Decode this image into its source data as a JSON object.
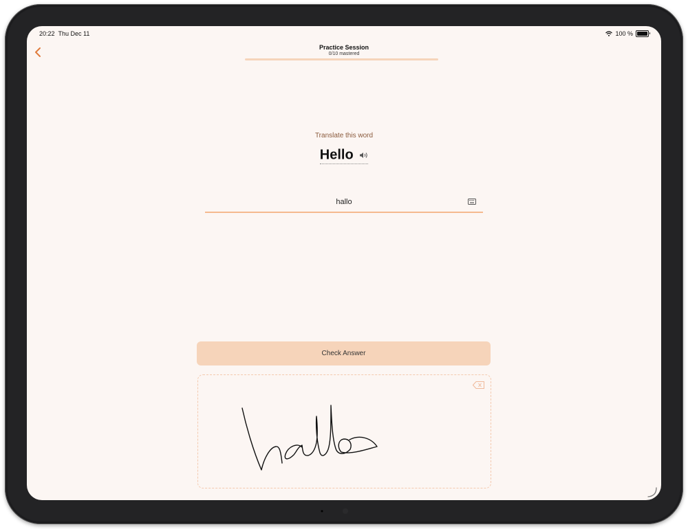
{
  "status_bar": {
    "time": "20:22",
    "date": "Thu Dec 11",
    "battery": "100 %"
  },
  "header": {
    "title": "Practice Session",
    "subtitle": "0/10 mastered",
    "progress": 0
  },
  "question": {
    "prompt": "Translate this word",
    "word": "Hello"
  },
  "answer": {
    "value": "hallo",
    "placeholder": ""
  },
  "actions": {
    "check_label": "Check Answer"
  },
  "handwriting": {
    "recognized": "hallo"
  },
  "icons": {
    "back": "chevron-left-icon",
    "speaker": "speaker-icon",
    "keyboard": "keyboard-icon",
    "clear": "delete-left-icon",
    "wifi": "wifi-icon",
    "battery": "battery-icon"
  },
  "colors": {
    "accent": "#e07b3c",
    "button": "#f6d4ba",
    "underline": "#f5b98e",
    "background": "#fcf6f3"
  }
}
